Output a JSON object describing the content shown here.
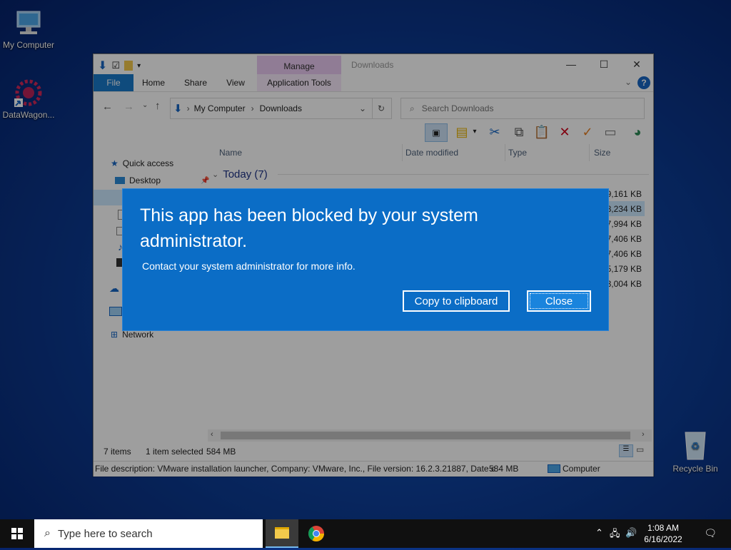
{
  "desktop": {
    "icons": [
      {
        "label": "My Computer"
      },
      {
        "label": "DataWagon..."
      },
      {
        "label": "Recycle Bin"
      }
    ]
  },
  "explorer": {
    "title": "Downloads",
    "contextual_tab_group": "Manage",
    "tabs": [
      "File",
      "Home",
      "Share",
      "View",
      "Application Tools"
    ],
    "address": {
      "segments": [
        "My Computer",
        "Downloads"
      ]
    },
    "search": {
      "placeholder": "Search Downloads"
    },
    "nav": {
      "quick_access": "Quick access",
      "desktop": "Desktop",
      "network": "Network"
    },
    "columns": [
      "Name",
      "Date modified",
      "Type",
      "Size"
    ],
    "group_header": "Today (7)",
    "file_sizes": [
      "9,161 KB",
      "48,234 KB",
      "77,994 KB",
      "37,406 KB",
      "37,406 KB",
      "5,179 KB",
      "43,004 KB"
    ],
    "status": {
      "items": "7 items",
      "selected": "1 item selected",
      "selected_size": "584 MB"
    },
    "description_bar": {
      "text": "File description: VMware installation launcher, Company: VMware, Inc., File version: 16.2.3.21887, Date c",
      "size": "584 MB",
      "location": "Computer"
    }
  },
  "dialog": {
    "title": "This app has been blocked by your system administrator.",
    "message": "Contact your system administrator for more info.",
    "copy_button": "Copy to clipboard",
    "close_button": "Close",
    "colors": {
      "background": "#0b6dc6"
    }
  },
  "taskbar": {
    "search_placeholder": "Type here to search",
    "time": "1:08 AM",
    "date": "6/16/2022"
  }
}
